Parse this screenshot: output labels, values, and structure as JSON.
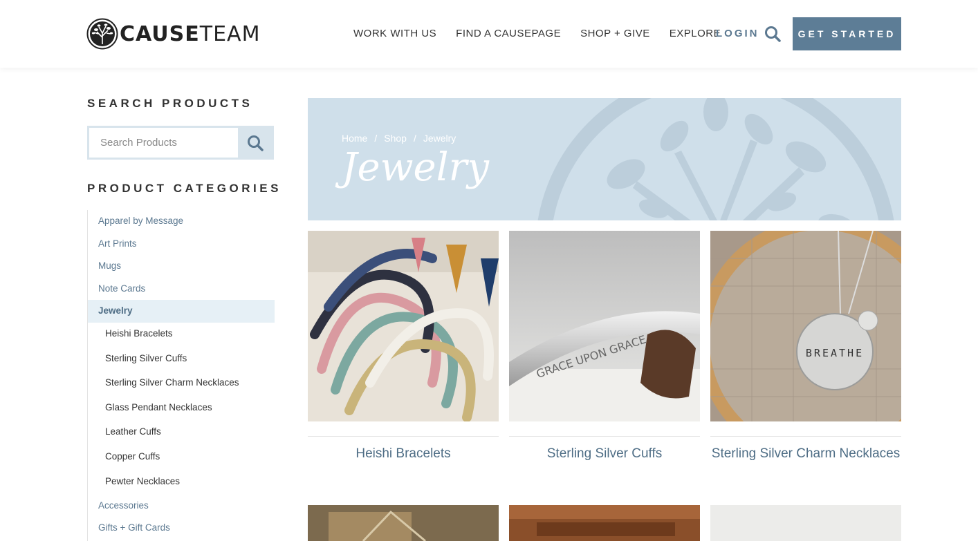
{
  "header": {
    "logo_bold": "CAUSE",
    "logo_light": "TEAM",
    "nav": [
      "WORK WITH US",
      "FIND A CAUSEPAGE",
      "SHOP + GIVE",
      "EXPLORE"
    ],
    "login": "LOGIN",
    "cta": "GET STARTED"
  },
  "sidebar": {
    "search_heading": "SEARCH PRODUCTS",
    "search_placeholder": "Search Products",
    "categories_heading": "PRODUCT CATEGORIES",
    "categories": [
      "Apparel by Message",
      "Art Prints",
      "Mugs",
      "Note Cards",
      "Jewelry"
    ],
    "subcategories": [
      "Heishi Bracelets",
      "Sterling Silver Cuffs",
      "Sterling Silver Charm Necklaces",
      "Glass Pendant Necklaces",
      "Leather Cuffs",
      "Copper Cuffs",
      "Pewter Necklaces"
    ],
    "more_categories": [
      "Accessories",
      "Gifts + Gift Cards"
    ]
  },
  "banner": {
    "breadcrumb": [
      "Home",
      "Shop",
      "Jewelry"
    ],
    "title": "Jewelry"
  },
  "products": [
    "Heishi Bracelets",
    "Sterling Silver Cuffs",
    "Sterling Silver Charm Necklaces"
  ],
  "cuff_text": "GRACE UPON GRACE",
  "charm_text": "BREATHE"
}
